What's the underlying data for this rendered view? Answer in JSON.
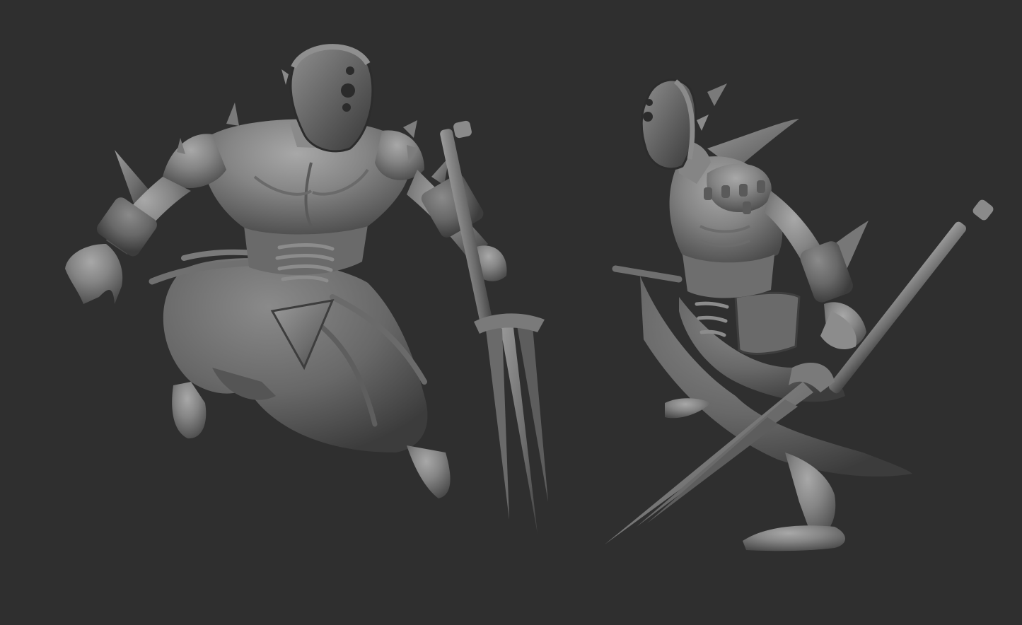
{
  "scene": {
    "background": "#2f2f2f",
    "clay_light": "#9a9a9a",
    "clay_mid": "#7a7a7a",
    "clay_dark": "#4e4e4e",
    "clay_shadow": "#3a3a3a",
    "subjects": [
      {
        "name": "masked-spear-warrior-front-view"
      },
      {
        "name": "masked-spear-warrior-side-view"
      }
    ]
  }
}
